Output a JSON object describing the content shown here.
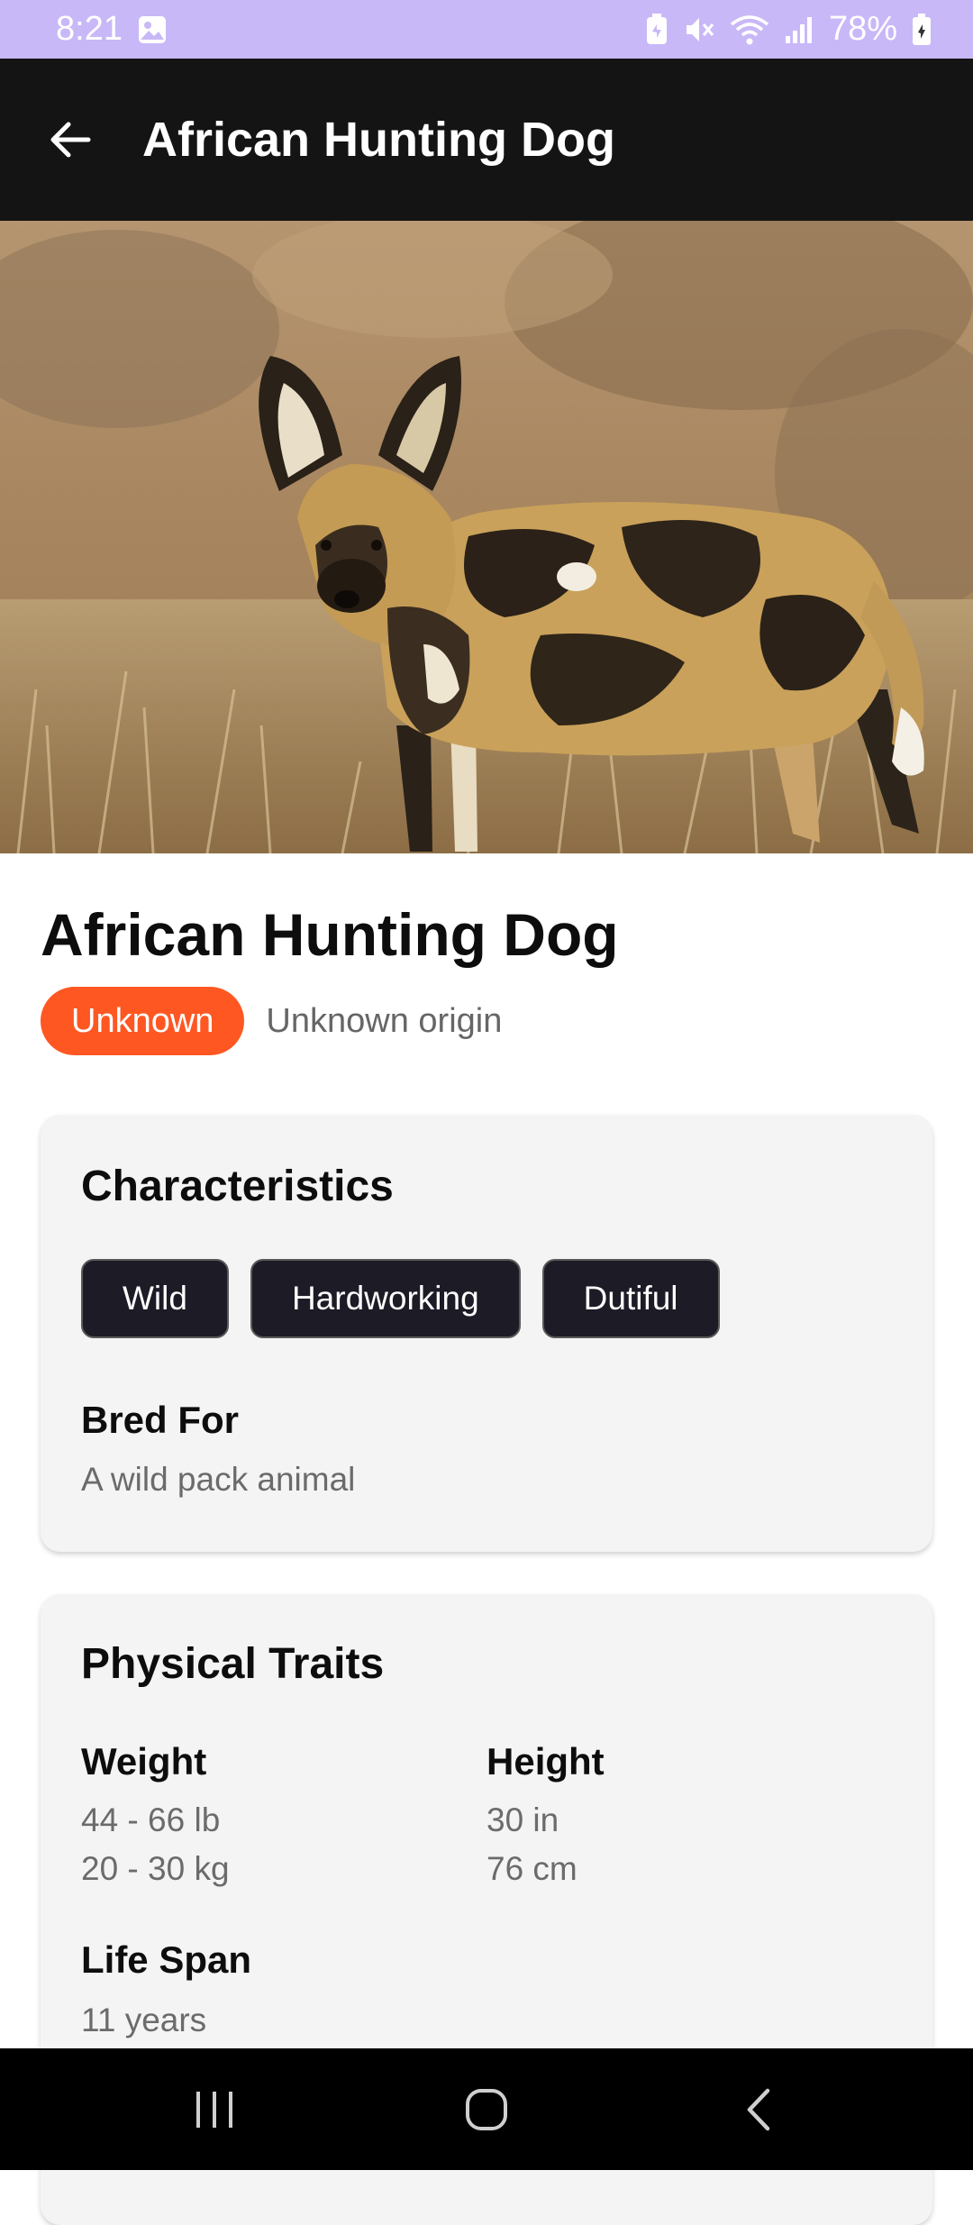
{
  "status_bar": {
    "time": "8:21",
    "battery": "78%",
    "icons": [
      "gallery-icon",
      "battery-saver-icon",
      "mute-icon",
      "wifi-icon",
      "signal-icon",
      "battery-icon"
    ]
  },
  "app_bar": {
    "title": "African Hunting Dog",
    "back_icon": "arrow-left-icon"
  },
  "hero": {
    "subject": "african-wild-dog-photo"
  },
  "breed": {
    "name": "African Hunting Dog",
    "size_badge": "Unknown",
    "origin": "Unknown origin"
  },
  "characteristics": {
    "title": "Characteristics",
    "temperament": [
      "Wild",
      "Hardworking",
      "Dutiful"
    ],
    "bred_for_label": "Bred For",
    "bred_for_value": "A wild pack animal"
  },
  "physical": {
    "title": "Physical Traits",
    "weight_label": "Weight",
    "weight_imperial": "44 - 66 lb",
    "weight_metric": "20 - 30 kg",
    "height_label": "Height",
    "height_imperial": "30 in",
    "height_metric": "76 cm",
    "lifespan_label": "Life Span",
    "lifespan_value": "11 years"
  },
  "nav": {
    "recents": "recents-icon",
    "home": "home-icon",
    "back": "back-icon"
  },
  "colors": {
    "status_bar": "#c9b8f7",
    "app_bar": "#141414",
    "badge": "#ff5722",
    "chip": "#1d1b26",
    "card": "#f4f4f4"
  }
}
